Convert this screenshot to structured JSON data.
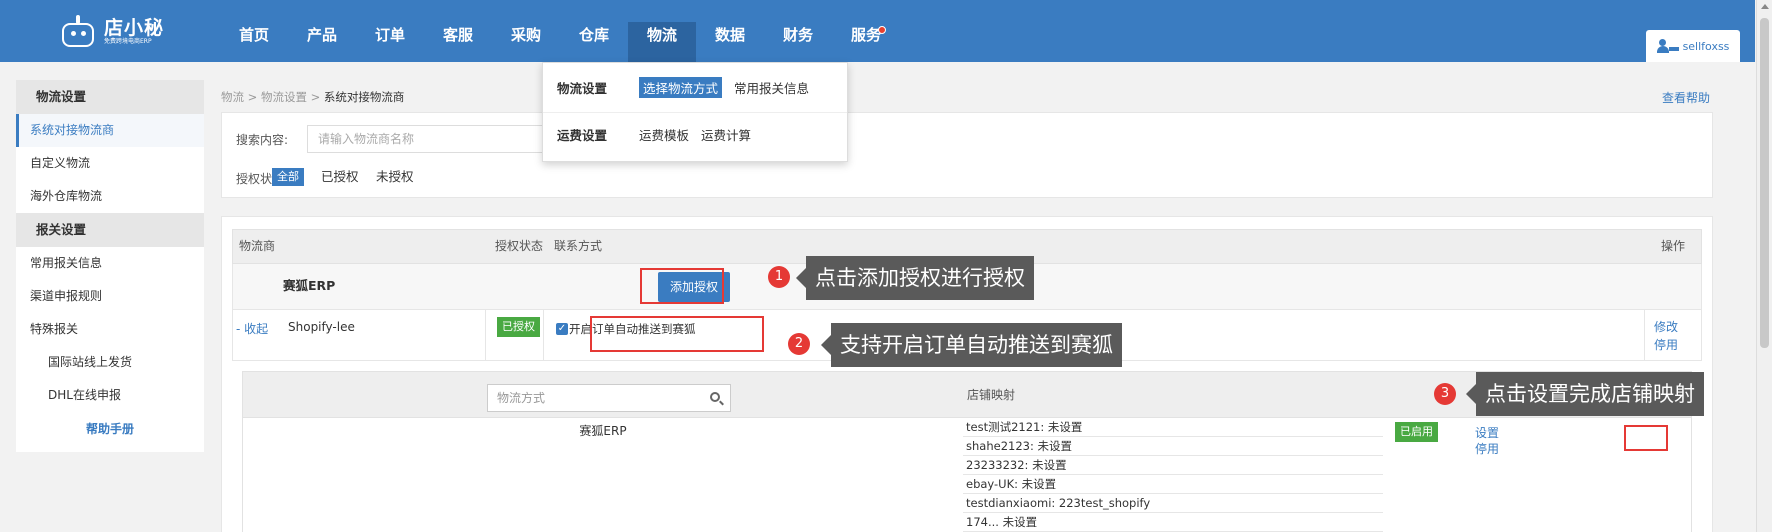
{
  "app": {
    "logo_name": "店小秘",
    "logo_sub": "免费跨境电商ERP",
    "user": "sellfoxss"
  },
  "nav": {
    "items": [
      "首页",
      "产品",
      "订单",
      "客服",
      "采购",
      "仓库",
      "物流",
      "数据",
      "财务",
      "服务"
    ],
    "active": "物流",
    "notification_dot_on": "服务"
  },
  "dropdown": {
    "row1_title": "物流设置",
    "row1_options": [
      "选择物流方式",
      "常用报关信息"
    ],
    "row1_selected": "选择物流方式",
    "row2_title": "运费设置",
    "row2_options": [
      "运费模板",
      "运费计算"
    ]
  },
  "sidebar": {
    "section1_title": "物流设置",
    "section1_items": [
      "系统对接物流商",
      "自定义物流",
      "海外仓库物流"
    ],
    "section1_active": "系统对接物流商",
    "section2_title": "报关设置",
    "section2_items": [
      "常用报关信息",
      "渠道申报规则",
      "特殊报关"
    ],
    "section2_subitems": [
      "国际站线上发货",
      "DHL在线申报"
    ],
    "help": "帮助手册"
  },
  "breadcrumb": {
    "level1": "物流",
    "level2": "物流设置",
    "current": "系统对接物流商",
    "separator": ">"
  },
  "help_link": "查看帮助",
  "filter": {
    "search_label": "搜索内容:",
    "search_placeholder": "请输入物流商名称",
    "status_label": "授权状态:",
    "status_options": [
      "全部",
      "已授权",
      "未授权"
    ],
    "status_selected": "全部"
  },
  "table": {
    "headers": {
      "carrier": "物流商",
      "auth_status": "授权状态",
      "contact": "联系方式",
      "actions": "操作"
    },
    "group_row": {
      "carrier": "赛狐ERP",
      "add_button": "添加授权"
    },
    "account_row": {
      "collapse": "- 收起",
      "name": "Shopify-lee",
      "status": "已授权",
      "auto_push_checked": true,
      "auto_push_label": "开启订单自动推送到赛狐",
      "edit": "修改",
      "disable": "停用"
    },
    "sub_table": {
      "search_placeholder": "物流方式",
      "store_mapping_header": "店铺映射",
      "method": "赛狐ERP",
      "stores": [
        "test测试2121:  未设置",
        "shahe2123:  未设置",
        "23233232:  未设置",
        "ebay-UK:  未设置",
        "testdianxiaomi:  223test_shopify",
        "174...  未设置"
      ],
      "status": "已启用",
      "set": "设置",
      "disable": "停用"
    }
  },
  "annotations": [
    {
      "number": "1",
      "text": "点击添加授权进行授权"
    },
    {
      "number": "2",
      "text": "支持开启订单自动推送到赛狐"
    },
    {
      "number": "3",
      "text": "点击设置完成店铺映射"
    }
  ],
  "colors": {
    "brand_blue": "#3a7cc1",
    "nav_active": "#2c64a0",
    "success_green": "#49a942",
    "annotation_red": "#e53935",
    "tooltip_gray": "#5a5a5a"
  }
}
